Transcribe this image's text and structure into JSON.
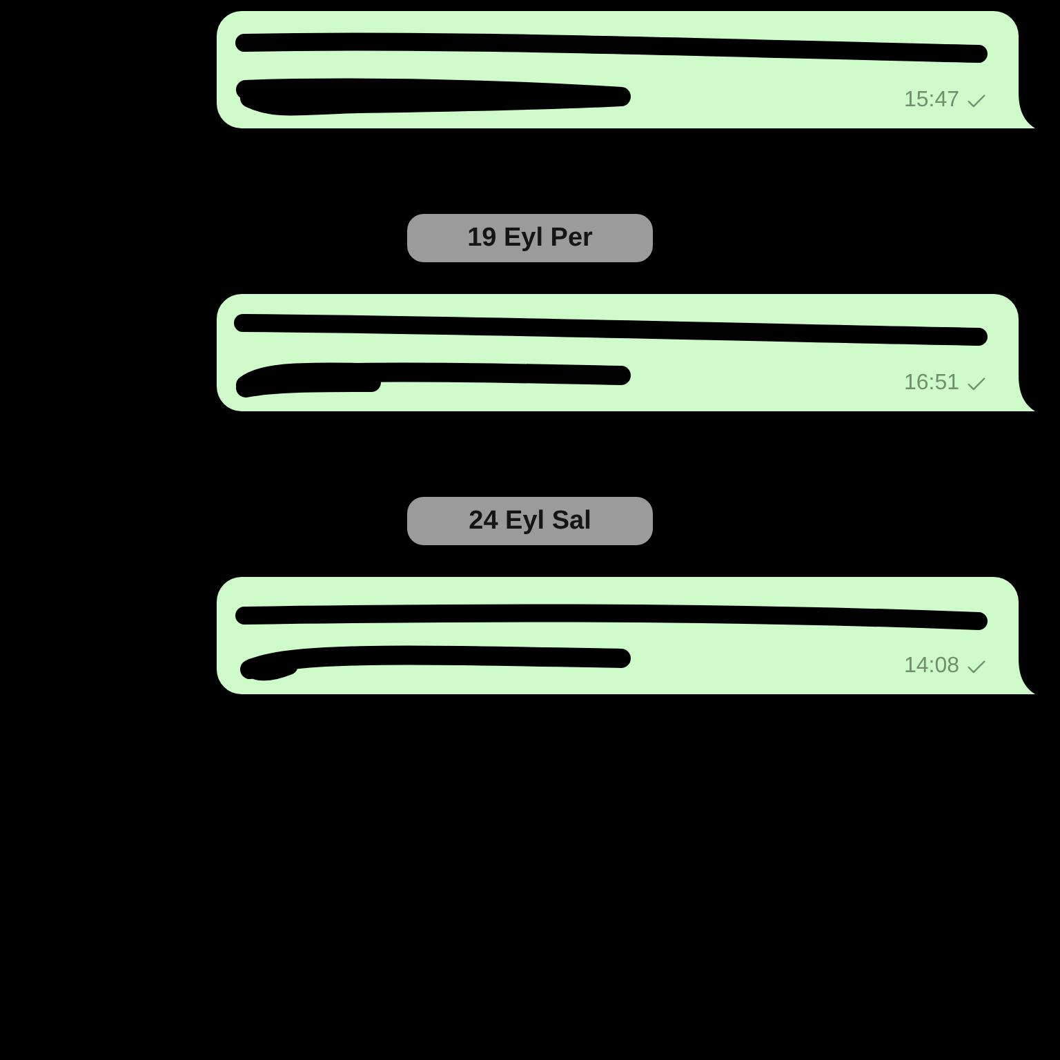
{
  "chat": {
    "items": [
      {
        "kind": "message",
        "time": "15:47",
        "delivered": false
      },
      {
        "kind": "date",
        "label": "19 Eyl Per"
      },
      {
        "kind": "message",
        "time": "16:51",
        "delivered": false
      },
      {
        "kind": "date",
        "label": "24 Eyl Sal"
      },
      {
        "kind": "message",
        "time": "14:08",
        "delivered": false
      }
    ]
  }
}
